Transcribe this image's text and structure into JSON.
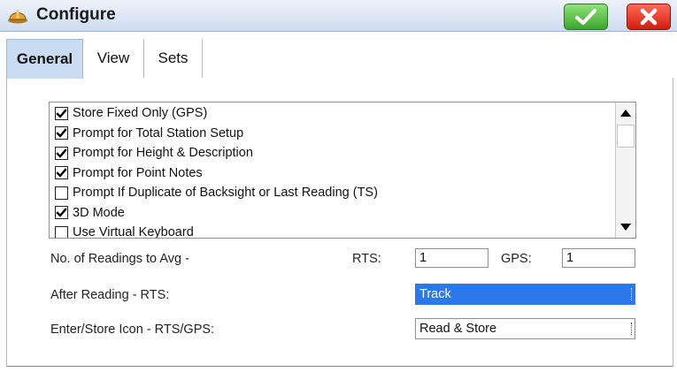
{
  "window": {
    "title": "Configure"
  },
  "tabs": [
    {
      "label": "General",
      "active": true
    },
    {
      "label": "View",
      "active": false
    },
    {
      "label": "Sets",
      "active": false
    }
  ],
  "options": [
    {
      "label": "Store Fixed Only (GPS)",
      "checked": true
    },
    {
      "label": "Prompt for Total Station Setup",
      "checked": true
    },
    {
      "label": "Prompt for Height & Description",
      "checked": true
    },
    {
      "label": "Prompt for Point Notes",
      "checked": true
    },
    {
      "label": "Prompt If Duplicate of Backsight or Last Reading (TS)",
      "checked": false
    },
    {
      "label": "3D Mode",
      "checked": true
    },
    {
      "label": "Use Virtual Keyboard",
      "checked": false
    }
  ],
  "readings": {
    "label": "No. of Readings to Avg  -",
    "rts_label": "RTS:",
    "rts_value": "1",
    "gps_label": "GPS:",
    "gps_value": "1"
  },
  "after_reading": {
    "label": "After Reading - RTS:",
    "value": "Track"
  },
  "enter_store": {
    "label": "Enter/Store Icon - RTS/GPS:",
    "value": "Read & Store"
  },
  "colors": {
    "accent": "#2b78ea",
    "ok": "#3da52c",
    "close": "#d11d0f",
    "tab_active": "#c9dcf1"
  },
  "icons": [
    "hardhat-icon",
    "checkmark-icon",
    "close-icon",
    "scroll-up-icon",
    "scroll-down-icon"
  ]
}
